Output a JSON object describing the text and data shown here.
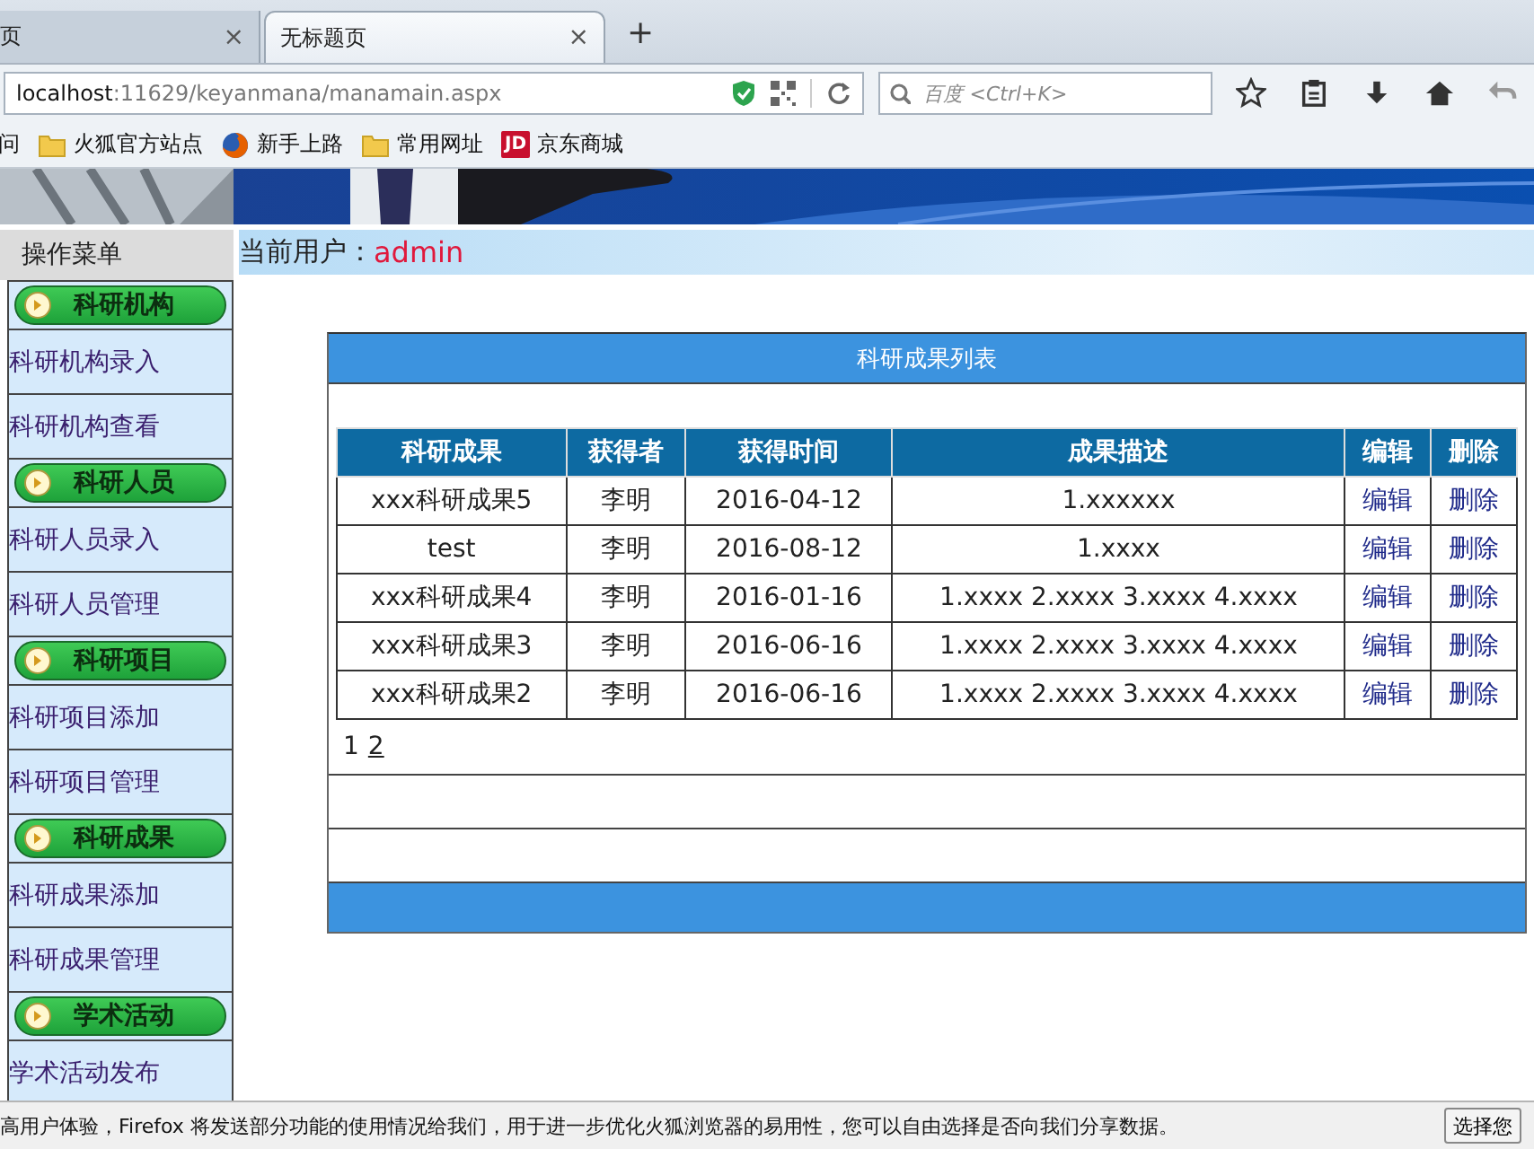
{
  "browser": {
    "tabs": [
      {
        "label": "页",
        "close": "×",
        "selected": false
      },
      {
        "label": "无标题页",
        "close": "×",
        "selected": true
      }
    ],
    "new_tab": "+",
    "address": {
      "host": "localhost",
      "path": ":11629/keyanmana/manamain.aspx"
    },
    "search": {
      "placeholder": "百度 <Ctrl+K>"
    },
    "bookmarks": [
      {
        "label": "问",
        "kind": "plain"
      },
      {
        "label": "火狐官方站点",
        "kind": "folder"
      },
      {
        "label": "新手上路",
        "kind": "firefox"
      },
      {
        "label": "常用网址",
        "kind": "folder"
      },
      {
        "label": "京东商城",
        "kind": "badge",
        "badge": "JD"
      }
    ]
  },
  "sidebar": {
    "title": "操作菜单",
    "groups": [
      {
        "title": "科研机构",
        "items": [
          "科研机构录入",
          "科研机构查看"
        ]
      },
      {
        "title": "科研人员",
        "items": [
          "科研人员录入",
          "科研人员管理"
        ]
      },
      {
        "title": "科研项目",
        "items": [
          "科研项目添加",
          "科研项目管理"
        ]
      },
      {
        "title": "科研成果",
        "items": [
          "科研成果添加",
          "科研成果管理"
        ]
      },
      {
        "title": "学术活动",
        "items": [
          "学术活动发布"
        ]
      }
    ]
  },
  "user_bar": {
    "label": "当前用户：",
    "user": "admin"
  },
  "panel": {
    "title": "科研成果列表",
    "table": {
      "columns": [
        "科研成果",
        "获得者",
        "获得时间",
        "成果描述",
        "编辑",
        "删除"
      ],
      "rows": [
        {
          "cells": [
            "xxx科研成果5",
            "李明",
            "2016-04-12",
            "1.xxxxxx"
          ],
          "edit": "编辑",
          "delete": "删除"
        },
        {
          "cells": [
            "test",
            "李明",
            "2016-08-12",
            "1.xxxx"
          ],
          "edit": "编辑",
          "delete": "删除"
        },
        {
          "cells": [
            "xxx科研成果4",
            "李明",
            "2016-01-16",
            "1.xxxx 2.xxxx 3.xxxx 4.xxxx"
          ],
          "edit": "编辑",
          "delete": "删除"
        },
        {
          "cells": [
            "xxx科研成果3",
            "李明",
            "2016-06-16",
            "1.xxxx 2.xxxx 3.xxxx 4.xxxx"
          ],
          "edit": "编辑",
          "delete": "删除"
        },
        {
          "cells": [
            "xxx科研成果2",
            "李明",
            "2016-06-16",
            "1.xxxx 2.xxxx 3.xxxx 4.xxxx"
          ],
          "edit": "编辑",
          "delete": "删除"
        }
      ]
    },
    "pager": [
      {
        "label": "1",
        "selected": true
      },
      {
        "label": "2",
        "selected": false
      }
    ]
  },
  "notification": {
    "text": "高用户体验，Firefox 将发送部分功能的使用情况给我们，用于进一步优化火狐浏览器的易用性，您可以自由选择是否向我们分享数据。",
    "button": "选择您"
  }
}
